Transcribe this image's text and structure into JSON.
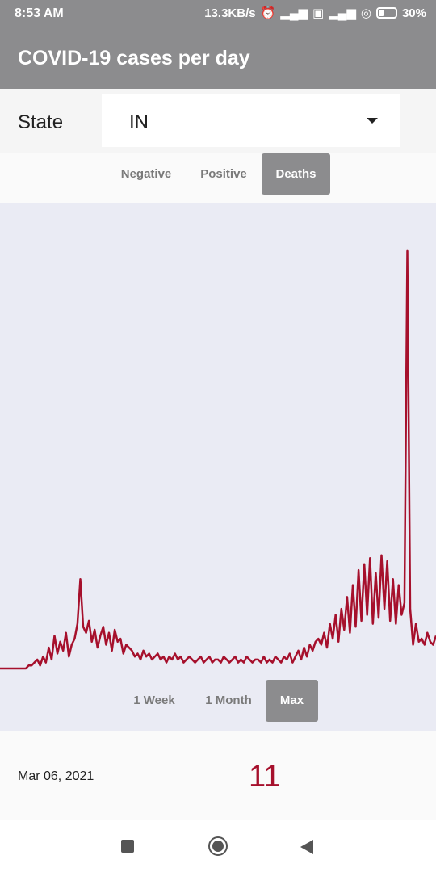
{
  "status_bar": {
    "time": "8:53 AM",
    "network_speed": "13.3KB/s",
    "battery": "30%",
    "icons": [
      "alarm-icon",
      "signal-icon",
      "volte-icon",
      "4g-signal-icon",
      "wifi-icon",
      "battery-icon"
    ]
  },
  "app": {
    "title": "COVID-19 cases per day"
  },
  "state": {
    "label": "State",
    "value": "IN"
  },
  "type_tabs": [
    {
      "label": "Negative",
      "active": false
    },
    {
      "label": "Positive",
      "active": false
    },
    {
      "label": "Deaths",
      "active": true
    }
  ],
  "range_tabs": [
    {
      "label": "1 Week",
      "active": false
    },
    {
      "label": "1 Month",
      "active": false
    },
    {
      "label": "Max",
      "active": true
    }
  ],
  "readout": {
    "date": "Mar 06, 2021",
    "value": "11"
  },
  "colors": {
    "accent": "#a6102c",
    "chrome": "#8c8c8e",
    "chart_bg": "#eaebf4"
  },
  "chart_data": {
    "type": "line",
    "series": [
      {
        "values": [
          0,
          0,
          0,
          0,
          0,
          0,
          0,
          0,
          0,
          0,
          1,
          1,
          2,
          3,
          1,
          4,
          2,
          7,
          3,
          11,
          5,
          9,
          6,
          12,
          4,
          8,
          10,
          15,
          30,
          14,
          12,
          16,
          9,
          13,
          7,
          11,
          14,
          8,
          12,
          6,
          13,
          9,
          10,
          5,
          8,
          7,
          6,
          4,
          5,
          3,
          6,
          4,
          5,
          3,
          4,
          5,
          3,
          4,
          2,
          4,
          3,
          5,
          3,
          4,
          2,
          3,
          4,
          3,
          2,
          3,
          4,
          2,
          3,
          4,
          2,
          3,
          3,
          2,
          4,
          3,
          2,
          3,
          4,
          2,
          3,
          2,
          4,
          3,
          2,
          3,
          3,
          2,
          4,
          2,
          3,
          2,
          4,
          3,
          2,
          4,
          3,
          5,
          2,
          4,
          6,
          3,
          7,
          4,
          8,
          6,
          9,
          10,
          8,
          12,
          7,
          15,
          10,
          18,
          9,
          20,
          13,
          24,
          12,
          28,
          14,
          33,
          16,
          35,
          18,
          37,
          15,
          32,
          17,
          38,
          20,
          36,
          16,
          30,
          15,
          28,
          18,
          22,
          140,
          20,
          8,
          15,
          9,
          10,
          8,
          12,
          9,
          8,
          11
        ]
      }
    ],
    "ylim": [
      0,
      150
    ],
    "grid": false
  }
}
